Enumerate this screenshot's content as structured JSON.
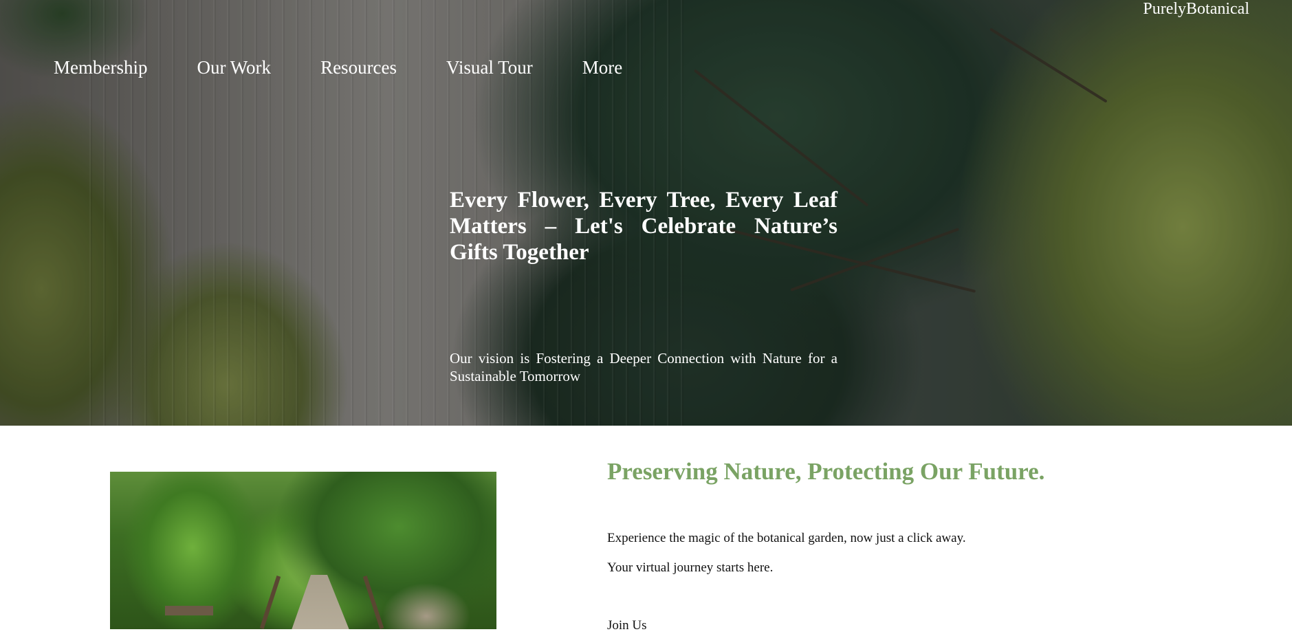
{
  "header": {
    "brand": "PurelyBotanical"
  },
  "nav": {
    "items": [
      {
        "label": "Membership"
      },
      {
        "label": "Our Work"
      },
      {
        "label": "Resources"
      },
      {
        "label": "Visual Tour"
      },
      {
        "label": "More"
      }
    ]
  },
  "hero": {
    "title": "Every Flower, Every Tree, Every Leaf Matters – Let's Celebrate Nature’s Gifts Together",
    "vision": "Our vision is Fostering a Deeper Connection with Nature for a Sustainable Tomorrow"
  },
  "intro": {
    "heading": "Preserving Nature, Protecting Our Future.",
    "line1": "Experience the magic of the botanical garden, now just a click away.",
    "line2": "Your virtual journey starts here.",
    "cta": "Join Us"
  },
  "colors": {
    "heading_green": "#7aa364",
    "hero_text": "#ffffff"
  }
}
